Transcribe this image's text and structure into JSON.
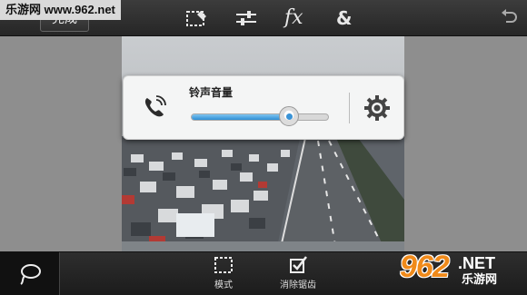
{
  "watermark_top": "乐游网 www.962.net",
  "top_bar": {
    "done_label": "完成",
    "fx_label": "fx",
    "amp_label": "&"
  },
  "volume_panel": {
    "title": "铃声音量",
    "level": 0.71
  },
  "bottom_bar": {
    "mode_label": "模式",
    "antialias_label": "消除锯齿"
  },
  "logo": {
    "number": "962",
    "net": ".NET",
    "cn": "乐游网"
  },
  "icons": {
    "close": "close-icon",
    "crop": "crop-icon",
    "adjust": "sliders-icon",
    "undo": "undo-icon",
    "phone": "phone-icon",
    "settings": "gear-icon",
    "lasso": "lasso-icon",
    "mode": "dashed-square-icon",
    "antialias": "checkbox-icon"
  }
}
